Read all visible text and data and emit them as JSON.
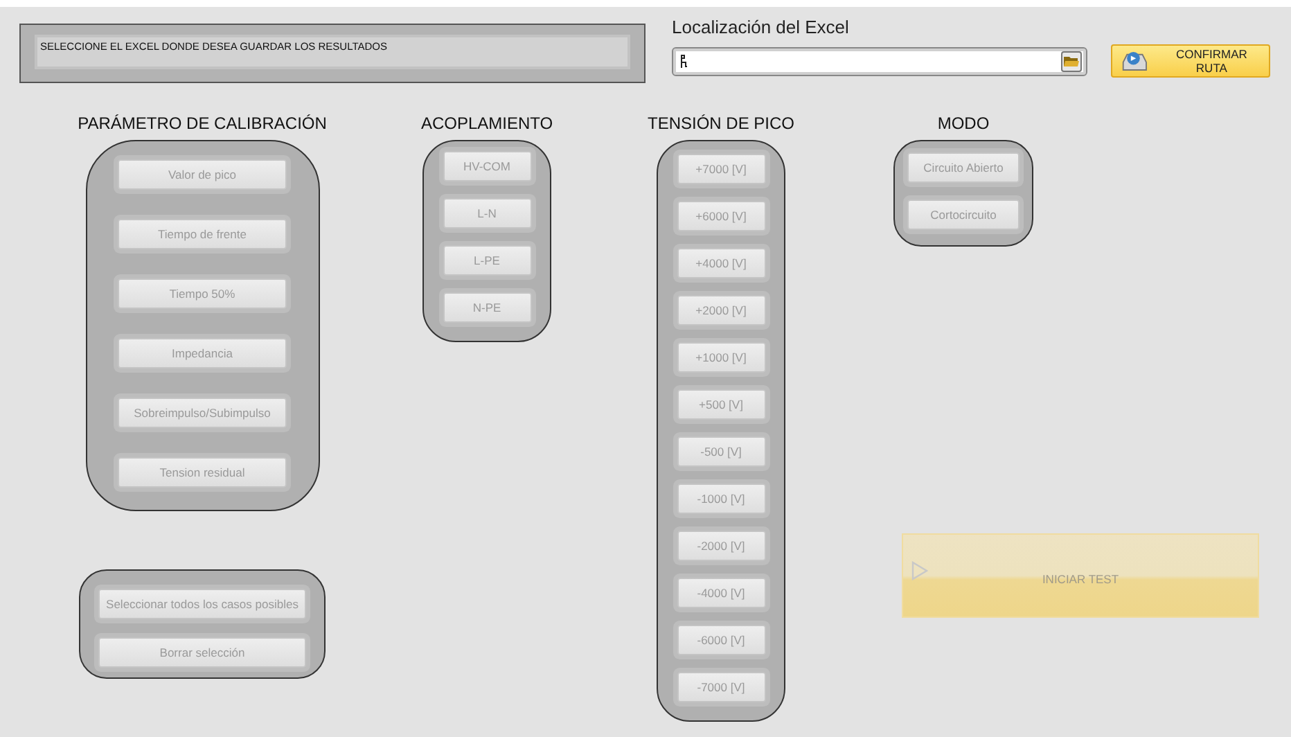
{
  "message_panel": {
    "text": "SELECCIONE EL EXCEL DONDE DESEA GUARDAR LOS RESULTADOS"
  },
  "path_control": {
    "label": "Localización del Excel"
  },
  "confirm_button": {
    "label": "CONFIRMAR RUTA",
    "disabled": false
  },
  "groups": [
    {
      "title": "PARÁMETRO DE CALIBRACIÓN",
      "buttons": [
        {
          "label": "Valor de pico",
          "disabled": true
        },
        {
          "label": "Tiempo de frente",
          "disabled": true
        },
        {
          "label": "Tiempo 50%",
          "disabled": true
        },
        {
          "label": "Impedancia",
          "disabled": true
        },
        {
          "label": "Sobreimpulso/Subimpulso",
          "disabled": true
        },
        {
          "label": "Tension residual",
          "disabled": true
        }
      ]
    },
    {
      "title": "ACOPLAMIENTO",
      "buttons": [
        {
          "label": "HV-COM",
          "disabled": true
        },
        {
          "label": "L-N",
          "disabled": true
        },
        {
          "label": "L-PE",
          "disabled": true
        },
        {
          "label": "N-PE",
          "disabled": true
        }
      ]
    },
    {
      "title": "TENSIÓN DE PICO",
      "buttons": [
        {
          "label": "+7000 [V]",
          "disabled": true
        },
        {
          "label": "+6000 [V]",
          "disabled": true
        },
        {
          "label": "+4000 [V]",
          "disabled": true
        },
        {
          "label": "+2000 [V]",
          "disabled": true
        },
        {
          "label": "+1000 [V]",
          "disabled": true
        },
        {
          "label": "+500 [V]",
          "disabled": true
        },
        {
          "label": "-500 [V]",
          "disabled": true
        },
        {
          "label": "-1000 [V]",
          "disabled": true
        },
        {
          "label": "-2000 [V]",
          "disabled": true
        },
        {
          "label": "-4000 [V]",
          "disabled": true
        },
        {
          "label": "-6000 [V]",
          "disabled": true
        },
        {
          "label": "-7000 [V]",
          "disabled": true
        }
      ]
    },
    {
      "title": "MODO",
      "buttons": [
        {
          "label": "Circuito Abierto",
          "disabled": true
        },
        {
          "label": "Cortocircuito",
          "disabled": true
        }
      ]
    }
  ],
  "selection_buttons": [
    {
      "label": "Seleccionar todos los casos posibles",
      "disabled": true
    },
    {
      "label": "Borrar selección",
      "disabled": true
    }
  ],
  "start_button": {
    "label": "INICIAR TEST",
    "disabled": true
  }
}
